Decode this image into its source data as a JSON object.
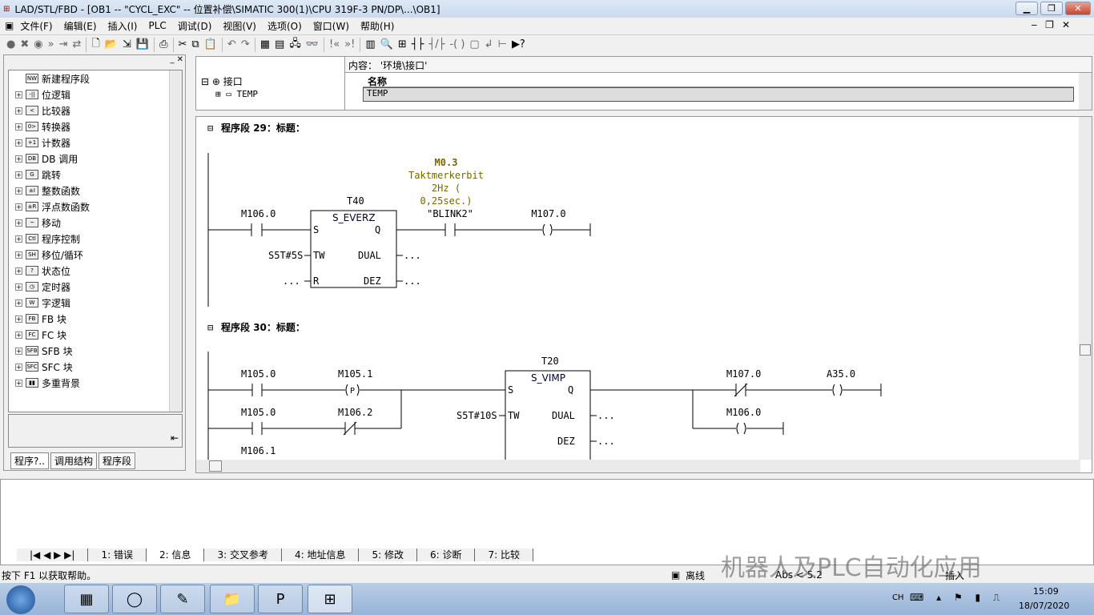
{
  "window": {
    "title": "LAD/STL/FBD  - [OB1 -- \"CYCL_EXC\" -- 位置补偿\\SIMATIC 300(1)\\CPU 319F-3 PN/DP\\...\\OB1]"
  },
  "menu": [
    "文件(F)",
    "编辑(E)",
    "插入(I)",
    "PLC",
    "调试(D)",
    "视图(V)",
    "选项(O)",
    "窗口(W)",
    "帮助(H)"
  ],
  "sidebar": {
    "items": [
      {
        "label": "新建程序段",
        "icon": "network-icon",
        "glyph": "NW"
      },
      {
        "label": "位逻辑",
        "icon": "bit-logic-icon",
        "glyph": "-||"
      },
      {
        "label": "比较器",
        "icon": "comparator-icon",
        "glyph": "<"
      },
      {
        "label": "转换器",
        "icon": "converter-icon",
        "glyph": "0>"
      },
      {
        "label": "计数器",
        "icon": "counter-icon",
        "glyph": "+1"
      },
      {
        "label": "DB 调用",
        "icon": "db-icon",
        "glyph": "DB"
      },
      {
        "label": "跳转",
        "icon": "jump-icon",
        "glyph": "G"
      },
      {
        "label": "整数函数",
        "icon": "integer-icon",
        "glyph": "±I"
      },
      {
        "label": "浮点数函数",
        "icon": "float-icon",
        "glyph": "±R"
      },
      {
        "label": "移动",
        "icon": "move-icon",
        "glyph": "~"
      },
      {
        "label": "程序控制",
        "icon": "program-control-icon",
        "glyph": "Ctl"
      },
      {
        "label": "移位/循环",
        "icon": "shift-icon",
        "glyph": "SH"
      },
      {
        "label": "状态位",
        "icon": "status-bit-icon",
        "glyph": "?"
      },
      {
        "label": "定时器",
        "icon": "timer-icon",
        "glyph": "◷"
      },
      {
        "label": "字逻辑",
        "icon": "word-logic-icon",
        "glyph": "W"
      },
      {
        "label": "FB 块",
        "icon": "fb-icon",
        "glyph": "FB"
      },
      {
        "label": "FC 块",
        "icon": "fc-icon",
        "glyph": "FC"
      },
      {
        "label": "SFB 块",
        "icon": "sfb-icon",
        "glyph": "SFB"
      },
      {
        "label": "SFC 块",
        "icon": "sfc-icon",
        "glyph": "SFC"
      },
      {
        "label": "多重背景",
        "icon": "multi-instance-icon",
        "glyph": "▮▮"
      }
    ],
    "tabs": [
      "程序?..",
      "调用结构",
      "程序段"
    ]
  },
  "interface": {
    "root": "接口",
    "child": "TEMP",
    "content_label": "内容： '环境\\接口'",
    "col_name": "名称",
    "row": "TEMP"
  },
  "net29": {
    "title_prefix": "程序段",
    "number": "29",
    "title_suffix": "：标题：",
    "in_contact": "M106.0",
    "timer": "T40",
    "block": "S_EVERZ",
    "s": "S",
    "q": "Q",
    "tw": "TW",
    "tw_val": "S5T#5S",
    "dual": "DUAL",
    "r": "R",
    "dez": "DEZ",
    "dots": "...",
    "comment_addr": "M0.3",
    "comment1": "Taktmerkerbit",
    "comment2": "2Hz (",
    "comment3": "0,25sec.)",
    "symbol": "\"BLINK2\"",
    "coil": "M107.0"
  },
  "net30": {
    "title_prefix": "程序段",
    "number": "30",
    "title_suffix": "：标题：",
    "c1": "M105.0",
    "p": "M105.1",
    "c2": "M105.0",
    "nc": "M106.2",
    "c3": "M106.1",
    "timer": "T20",
    "block": "S_VIMP",
    "s": "S",
    "q": "Q",
    "tw": "TW",
    "tw_val": "S5T#10S",
    "dual": "DUAL",
    "dez": "DEZ",
    "dots": "...",
    "nc2": "M107.0",
    "coil1": "A35.0",
    "coil2": "M106.0",
    "ptag": "P"
  },
  "output_tabs": [
    "1: 错误",
    "2: 信息",
    "3: 交叉参考",
    "4: 地址信息",
    "5: 修改",
    "6: 诊断",
    "7: 比较"
  ],
  "status": {
    "help": "按下 F1 以获取帮助。",
    "mode": "离线",
    "abs": "Abs < 5.2",
    "insert": "插入"
  },
  "watermark": "机器人及PLC自动化应用",
  "taskbar": {
    "lang": "CH",
    "time": "15:09",
    "date": "18/07/2020"
  }
}
